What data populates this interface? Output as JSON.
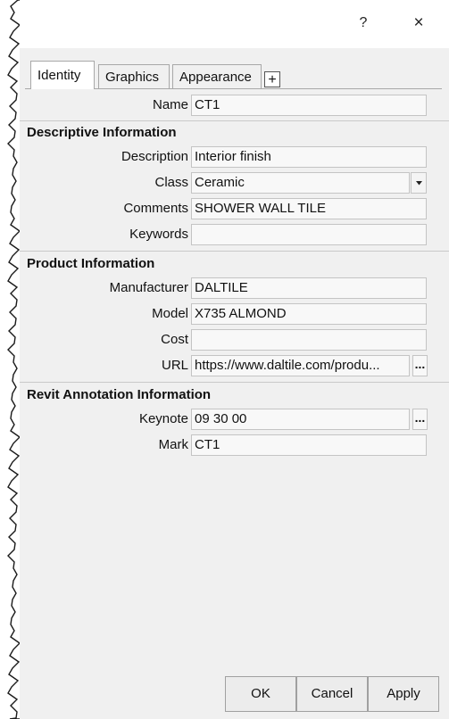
{
  "title_bar": {
    "help_label": "?",
    "close_label": "×"
  },
  "tabs": [
    {
      "label": "Identity",
      "active": true
    },
    {
      "label": "Graphics",
      "active": false
    },
    {
      "label": "Appearance",
      "active": false
    }
  ],
  "add_tab_label": "+",
  "name_row": {
    "label": "Name",
    "value": "CT1"
  },
  "descriptive": {
    "header": "Descriptive Information",
    "description": {
      "label": "Description",
      "value": "Interior finish"
    },
    "class": {
      "label": "Class",
      "value": "Ceramic"
    },
    "comments": {
      "label": "Comments",
      "value": "SHOWER WALL TILE"
    },
    "keywords": {
      "label": "Keywords",
      "value": ""
    }
  },
  "product": {
    "header": "Product Information",
    "manufacturer": {
      "label": "Manufacturer",
      "value": "DALTILE"
    },
    "model": {
      "label": "Model",
      "value": "X735 ALMOND"
    },
    "cost": {
      "label": "Cost",
      "value": ""
    },
    "url": {
      "label": "URL",
      "value": "https://www.daltile.com/produ..."
    }
  },
  "revit": {
    "header": "Revit Annotation Information",
    "keynote": {
      "label": "Keynote",
      "value": "09 30 00"
    },
    "mark": {
      "label": "Mark",
      "value": "CT1"
    }
  },
  "browse_label": "...",
  "buttons": {
    "ok": "OK",
    "cancel": "Cancel",
    "apply": "Apply"
  },
  "colors": {
    "panel_bg": "#f0f0f0",
    "field_bg": "#f8f8f8",
    "border": "#a8a8a8"
  }
}
